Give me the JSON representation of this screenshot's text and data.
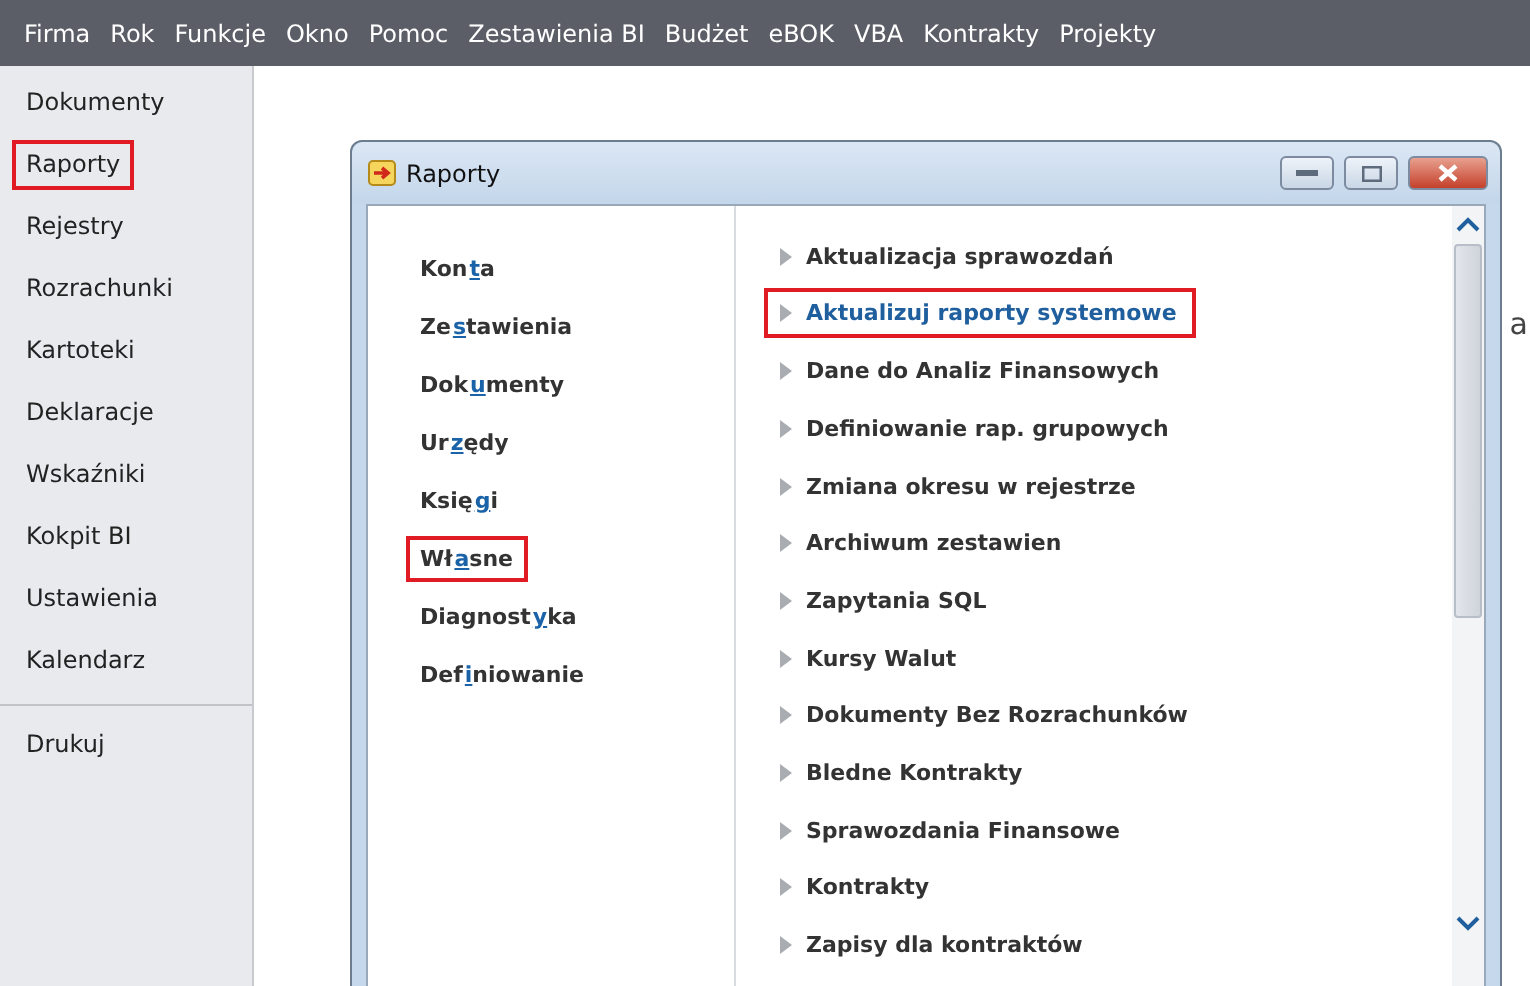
{
  "menu_bar": [
    "Firma",
    "Rok",
    "Funkcje",
    "Okno",
    "Pomoc",
    "Zestawienia BI",
    "Budżet",
    "eBOK",
    "VBA",
    "Kontrakty",
    "Projekty"
  ],
  "sidebar": {
    "items": [
      {
        "label": "Dokumenty",
        "highlighted": false
      },
      {
        "label": "Raporty",
        "highlighted": true
      },
      {
        "label": "Rejestry",
        "highlighted": false
      },
      {
        "label": "Rozrachunki",
        "highlighted": false
      },
      {
        "label": "Kartoteki",
        "highlighted": false
      },
      {
        "label": "Deklaracje",
        "highlighted": false
      },
      {
        "label": "Wskaźniki",
        "highlighted": false
      },
      {
        "label": "Kokpit BI",
        "highlighted": false
      },
      {
        "label": "Ustawienia",
        "highlighted": false
      },
      {
        "label": "Kalendarz",
        "highlighted": false
      }
    ],
    "footer_items": [
      "Drukuj"
    ]
  },
  "background_fragment": "a",
  "dialog": {
    "title": "Raporty",
    "categories": [
      {
        "before": "Kon",
        "key": "t",
        "after": "a",
        "highlighted": false
      },
      {
        "before": "Ze",
        "key": "s",
        "after": "tawienia",
        "highlighted": false
      },
      {
        "before": "Dok",
        "key": "u",
        "after": "menty",
        "highlighted": false
      },
      {
        "before": "Ur",
        "key": "z",
        "after": "ędy",
        "highlighted": false
      },
      {
        "before": "Księ",
        "key": "g",
        "after": "i",
        "highlighted": false
      },
      {
        "before": "Wł",
        "key": "a",
        "after": "sne",
        "highlighted": true
      },
      {
        "before": "Diagnost",
        "key": "y",
        "after": "ka",
        "highlighted": false
      },
      {
        "before": "Def",
        "key": "i",
        "after": "niowanie",
        "highlighted": false
      }
    ],
    "reports": [
      {
        "label": "Aktualizacja sprawozdań",
        "highlighted": false
      },
      {
        "label": "Aktualizuj raporty systemowe",
        "highlighted": true
      },
      {
        "label": "Dane do Analiz Finansowych",
        "highlighted": false
      },
      {
        "label": "Definiowanie rap. grupowych",
        "highlighted": false
      },
      {
        "label": "Zmiana okresu w rejestrze",
        "highlighted": false
      },
      {
        "label": "Archiwum zestawien",
        "highlighted": false
      },
      {
        "label": "Zapytania SQL",
        "highlighted": false
      },
      {
        "label": "Kursy Walut",
        "highlighted": false
      },
      {
        "label": "Dokumenty Bez Rozrachunków",
        "highlighted": false
      },
      {
        "label": "Bledne Kontrakty",
        "highlighted": false
      },
      {
        "label": "Sprawozdania Finansowe",
        "highlighted": false
      },
      {
        "label": "Kontrakty",
        "highlighted": false
      },
      {
        "label": "Zapisy dla kontraktów",
        "highlighted": false
      }
    ]
  }
}
